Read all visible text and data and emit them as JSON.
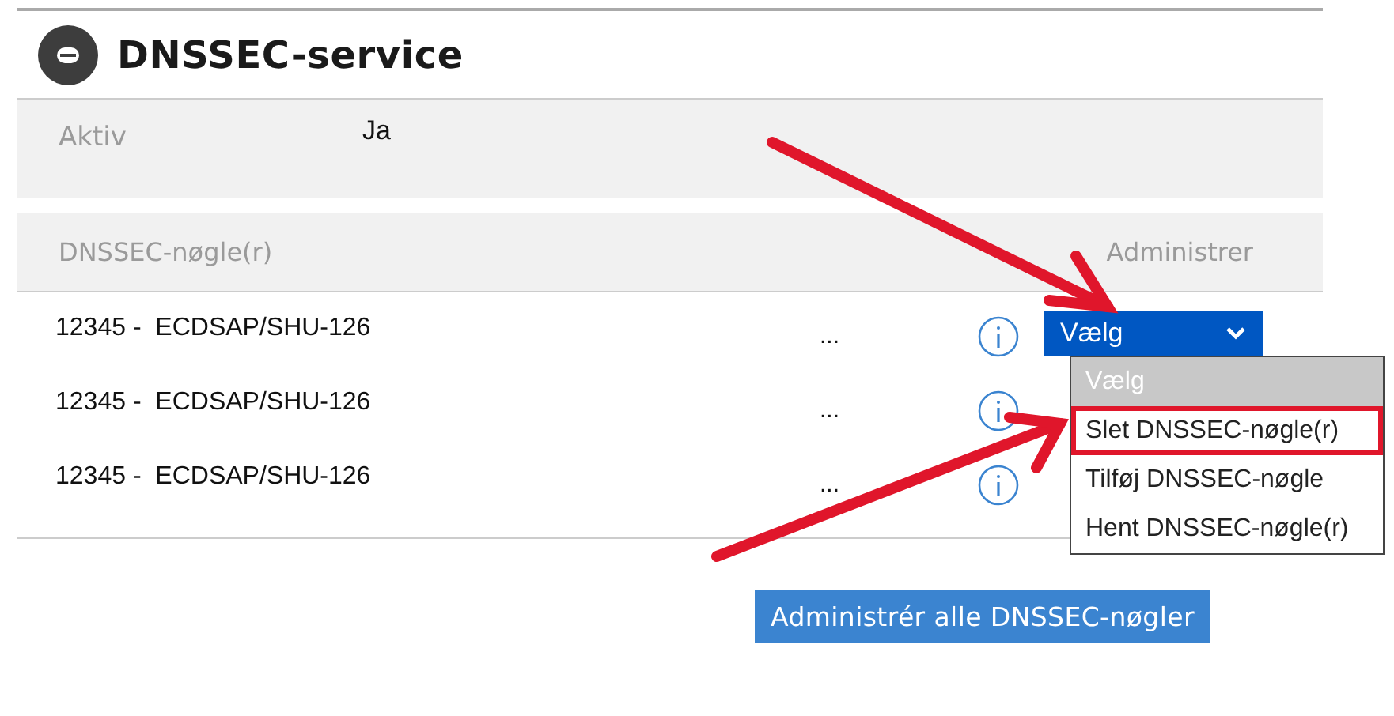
{
  "title": "DNSSEC-service",
  "status": {
    "label": "Aktiv",
    "value": "Ja"
  },
  "table": {
    "columns": [
      "DNSSEC-nøgle(r)",
      "Administrer"
    ],
    "rows": [
      {
        "key": "12345 -  ECDSAP/SHU-126",
        "extra": "..."
      },
      {
        "key": "12345 -  ECDSAP/SHU-126",
        "extra": "..."
      },
      {
        "key": "12345 -  ECDSAP/SHU-126",
        "extra": "..."
      }
    ]
  },
  "dropdown": {
    "value": "Vælg",
    "expanded": true,
    "options": [
      {
        "label": "Vælg",
        "selected": true,
        "highlighted": false
      },
      {
        "label": "Slet DNSSEC-nøgle(r)",
        "selected": false,
        "highlighted": true
      },
      {
        "label": "Tilføj DNSSEC-nøgle",
        "selected": false,
        "highlighted": false
      },
      {
        "label": "Hent DNSSEC-nøgle(r)",
        "selected": false,
        "highlighted": false
      }
    ]
  },
  "manage_all_button": "Administrér alle DNSSEC-nøgler"
}
